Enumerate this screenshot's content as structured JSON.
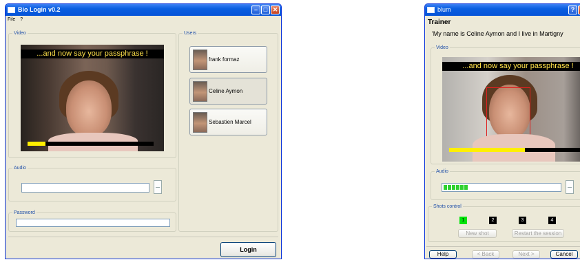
{
  "left_window": {
    "title": "Bio Login v0.2",
    "menu": [
      "File",
      "?"
    ],
    "video_legend": "Video",
    "banner": "...and now say your passphrase !",
    "audio_legend": "Audio",
    "password_legend": "Password",
    "password_value": "",
    "users_legend": "Users",
    "users": [
      {
        "name": "frank formaz",
        "selected": false
      },
      {
        "name": "Celine Aymon",
        "selected": true
      },
      {
        "name": "Sebastien Marcel",
        "selected": false
      }
    ],
    "login_label": "Login",
    "video_progress": 0.14
  },
  "right_window": {
    "title": "blum",
    "heading": "Trainer",
    "prompt": "'My name is Celine Aymon and I live in Martigny",
    "video_legend": "Video",
    "banner": "...and now say your passphrase !",
    "video_progress": 0.55,
    "audio_legend": "Audio",
    "audio_level_segments": 6,
    "shots_legend": "Shots control",
    "shots": [
      {
        "label": "1",
        "done": true
      },
      {
        "label": "2",
        "done": false
      },
      {
        "label": "3",
        "done": false
      },
      {
        "label": "4",
        "done": false
      }
    ],
    "new_shot_label": "New shot",
    "restart_label": "Restart the session",
    "help_label": "Help",
    "back_label": "< Back",
    "next_label": "Next >",
    "cancel_label": "Cancel"
  },
  "colors": {
    "titlebar_blue": "#0a5ee0",
    "window_bg": "#ece9d8",
    "legend_blue": "#1f4fa8",
    "banner_yellow": "#ffe14a",
    "shot_done_green": "#00e40a"
  },
  "icons": [
    "app-icon",
    "minimize-icon",
    "maximize-icon",
    "close-icon",
    "help-icon",
    "audio-meter-icon"
  ]
}
